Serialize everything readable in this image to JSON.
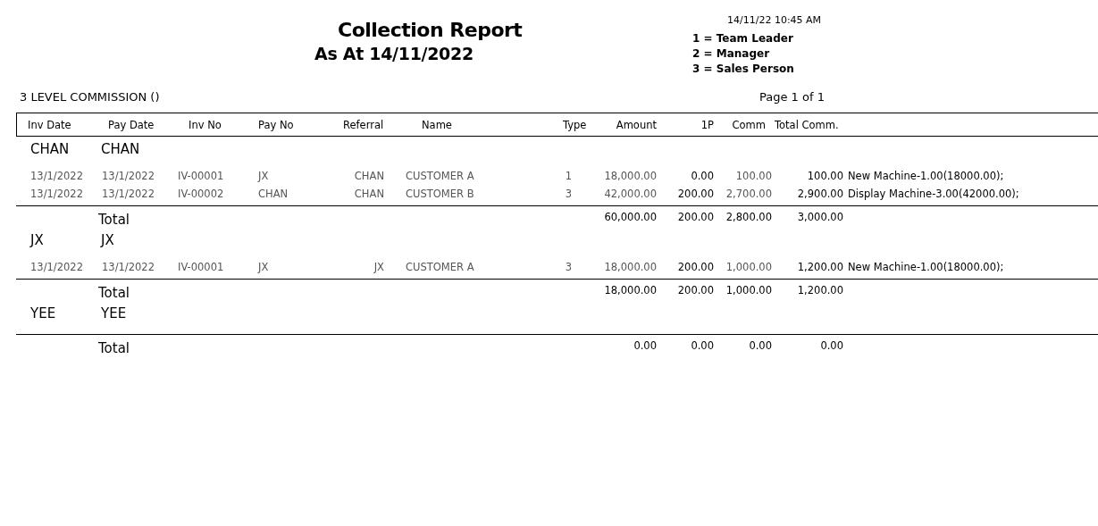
{
  "report": {
    "title": "Collection Report",
    "subtitle": "As At 14/11/2022",
    "printed_at": "14/11/22 10:45 AM",
    "legend": [
      "1 = Team Leader",
      "2 = Manager",
      "3 = Sales Person"
    ],
    "section_title": "3 LEVEL COMMISSION ()",
    "page": "Page 1 of 1"
  },
  "table": {
    "columns": [
      "Inv Date",
      "Pay Date",
      "Inv No",
      "Pay No",
      "Referral",
      "Name",
      "Type",
      "Amount",
      "1P",
      "Comm",
      "Total Comm."
    ],
    "groups": [
      {
        "code": "CHAN",
        "name": "CHAN",
        "rows": [
          {
            "cells": [
              "13/1/2022",
              "13/1/2022",
              "IV-00001",
              "JX",
              "CHAN",
              "CUSTOMER A",
              "1",
              "18,000.00",
              "0.00",
              "100.00",
              "100.00",
              "New Machine-1.00(18000.00);"
            ]
          },
          {
            "cells": [
              "13/1/2022",
              "13/1/2022",
              "IV-00002",
              "CHAN",
              "CHAN",
              "CUSTOMER B",
              "3",
              "42,000.00",
              "200.00",
              "2,700.00",
              "2,900.00",
              "Display Machine-3.00(42000.00);"
            ]
          }
        ],
        "total_label": "Total",
        "totals": [
          "60,000.00",
          "200.00",
          "2,800.00",
          "3,000.00"
        ]
      },
      {
        "code": "JX",
        "name": "JX",
        "rows": [
          {
            "cells": [
              "13/1/2022",
              "13/1/2022",
              "IV-00001",
              "JX",
              "JX",
              "CUSTOMER A",
              "3",
              "18,000.00",
              "200.00",
              "1,000.00",
              "1,200.00",
              "New Machine-1.00(18000.00);"
            ]
          }
        ],
        "total_label": "Total",
        "totals": [
          "18,000.00",
          "200.00",
          "1,000.00",
          "1,200.00"
        ]
      },
      {
        "code": "YEE",
        "name": "YEE",
        "total_label": "Total",
        "totals": [
          "0.00",
          "0.00",
          "0.00",
          "0.00"
        ]
      }
    ]
  }
}
